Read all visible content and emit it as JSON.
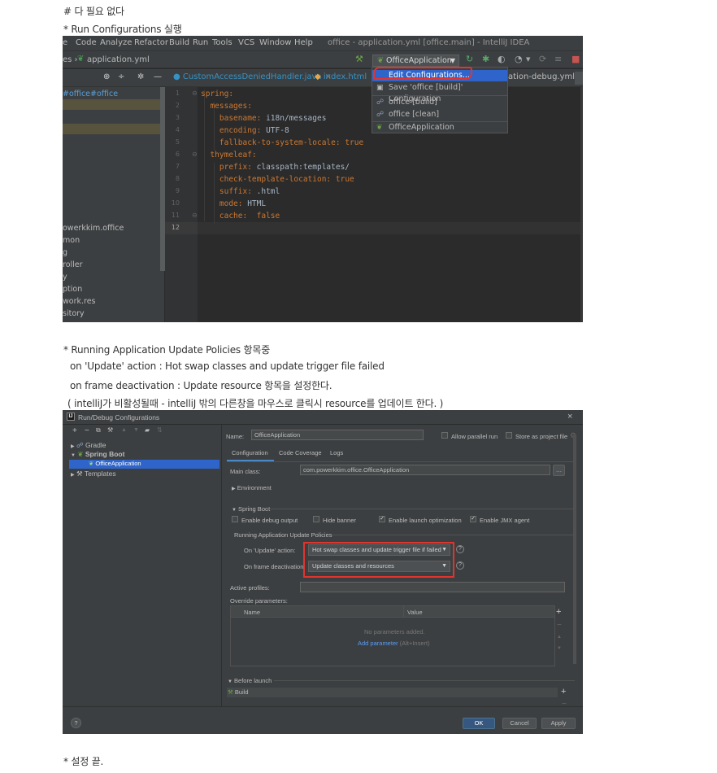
{
  "text": {
    "line1": "# 다 필요 없다",
    "line2": "* Run Configurations 실행",
    "line3": "* Running Application Update Policies 항목중",
    "line4": "on 'Update' action     : Hot swap classes and update trigger file failed",
    "line5": "on frame deactivation :  Update resource 항목을 설정한다.",
    "line6": "( intelliJ가 비활성될때 - intelliJ 밖의 다른창을 마우스로 클릭시 resource를 업데이트 한다. )",
    "line7": "* 설정 끝."
  },
  "shot1": {
    "menu": {
      "m_file": "e",
      "m_code": "Code",
      "m_analyze": "Analyze",
      "m_refactor": "Refactor",
      "m_build": "Build",
      "m_run": "Run",
      "m_tools": "Tools",
      "m_vcs": "VCS",
      "m_window": "Window",
      "m_help": "Help",
      "window_title": "office - application.yml [office.main] - IntelliJ IDEA"
    },
    "breadcrumb_prefix": "es ›",
    "breadcrumb_file": "application.yml",
    "run_config": "OfficeApplication",
    "tabs": {
      "t1": "CustomAccessDeniedHandler.java",
      "t2": "index.html",
      "t3": "ation-debug.yml"
    },
    "project_tree": {
      "root": "#office#office",
      "p1": "owerkkim.office",
      "p2": "mon",
      "p3": "g",
      "p4": "roller",
      "p5": "y",
      "p6": "ption",
      "p7": "work.res",
      "p8": "sitory"
    },
    "line_numbers": [
      "1",
      "2",
      "3",
      "4",
      "5",
      "6",
      "7",
      "8",
      "9",
      "10",
      "11",
      "12"
    ],
    "code": {
      "c1k": "spring:",
      "c2k": "  messages:",
      "c3k": "    basename: ",
      "c3v": "i18n/messages",
      "c4k": "    encoding: ",
      "c4v": "UTF-8",
      "c5k": "    fallback-to-system-locale: ",
      "c5v": "true",
      "c6k": "  thymeleaf:",
      "c7k": "    prefix: ",
      "c7v": "classpath:templates/",
      "c8k": "    check-template-location: ",
      "c8v": "true",
      "c9k": "    suffix: ",
      "c9v": ".html",
      "c10k": "    mode: ",
      "c10v": "HTML",
      "c11k": "    cache:  ",
      "c11v": "false"
    },
    "popup": {
      "edit": "Edit Configurations...",
      "save": "Save 'office [build]' Configuration",
      "build": "office [build]",
      "clean": "office [clean]",
      "app": "OfficeApplication"
    }
  },
  "shot2": {
    "title": "Run/Debug Configurations",
    "tree": {
      "gradle": "Gradle",
      "spring_boot": "Spring Boot",
      "office_app": "OfficeApplication",
      "templates": "Templates"
    },
    "name_label": "Name:",
    "name_value": "OfficeApplication",
    "allow_parallel": "Allow parallel run",
    "store_project": "Store as project file",
    "tabs": {
      "configuration": "Configuration",
      "code_coverage": "Code Coverage",
      "logs": "Logs"
    },
    "main_class_label": "Main class:",
    "main_class_value": "com.powerkkim.office.OfficeApplication",
    "environment": "Environment",
    "spring_boot_section": "Spring Boot",
    "enable_debug": "Enable debug output",
    "hide_banner": "Hide banner",
    "enable_launch": "Enable launch optimization",
    "enable_jmx": "Enable JMX agent",
    "policies_title": "Running Application Update Policies",
    "on_update_label": "On 'Update' action:",
    "on_update_value": "Hot swap classes and update trigger file if failed",
    "on_frame_label": "On frame deactivation:",
    "on_frame_value": "Update classes and resources",
    "active_profiles": "Active profiles:",
    "override_params": "Override parameters:",
    "col_name": "Name",
    "col_value": "Value",
    "no_params": "No parameters added.",
    "add_param": "Add parameter",
    "add_param_hint": "(Alt+Insert)",
    "before_launch": "Before launch",
    "build": "Build",
    "ok": "OK",
    "cancel": "Cancel",
    "apply": "Apply",
    "help": "?"
  }
}
